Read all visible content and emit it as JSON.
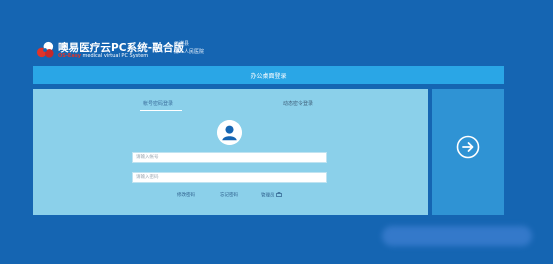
{
  "brand": {
    "title": "噢易医疗云PC系统-融合版",
    "subtitle_brand": "OS-Easy",
    "subtitle": "medical virtual PC System"
  },
  "region": {
    "county": "元谋县",
    "hospital": "第二人民医院"
  },
  "page": {
    "title": "办公桌面登录"
  },
  "login": {
    "tabs": [
      {
        "label": "帐号密码登录",
        "active": true
      },
      {
        "label": "动态密令登录",
        "active": false
      }
    ],
    "account_placeholder": "请输入帐号",
    "password_placeholder": "请输入密码",
    "links": {
      "forgot": "修改密码",
      "remember": "忘记密码",
      "manage": "管理员"
    }
  },
  "colors": {
    "background": "#1565b2",
    "title_bar": "#2aa6e6",
    "login_panel": "#8bd0ea",
    "submit_panel": "#2f93d4",
    "logo_red": "#e0342a"
  },
  "icons": {
    "logo": "logo-icon",
    "avatar": "user-avatar-icon",
    "submit": "arrow-right-circle-icon",
    "admin": "admin-icon"
  }
}
